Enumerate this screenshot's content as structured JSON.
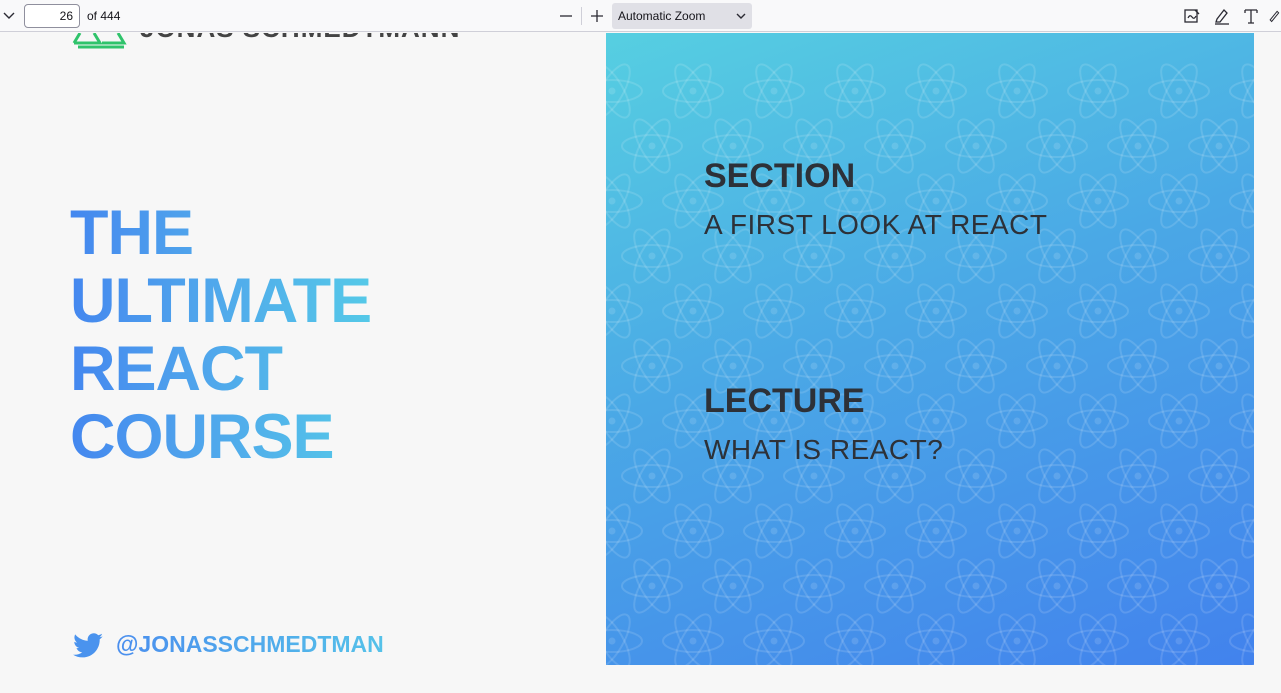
{
  "toolbar": {
    "page_number": "26",
    "page_total": "of 444",
    "zoom": "Automatic Zoom",
    "icons": [
      "sidebar-chevron-icon",
      "zoom-out-icon",
      "zoom-in-icon",
      "signature-icon",
      "highlight-icon",
      "text-icon",
      "draw-icon"
    ]
  },
  "slide": {
    "brand": "JONAS SCHMEDTMANN",
    "title_lines": [
      "THE",
      "ULTIMATE",
      "REACT",
      "COURSE"
    ],
    "twitter_handle": "@JONASSCHMEDTMAN",
    "section_label": "SECTION",
    "section_title": "A FIRST LOOK AT REACT",
    "lecture_label": "LECTURE",
    "lecture_title": "WHAT IS REACT?"
  },
  "colors": {
    "title_gradient_start": "#4487ef",
    "title_gradient_end": "#55c9e8",
    "panel_top": "#56cfe1",
    "panel_bottom": "#4282ed",
    "logo_green": "#2fc36b"
  }
}
